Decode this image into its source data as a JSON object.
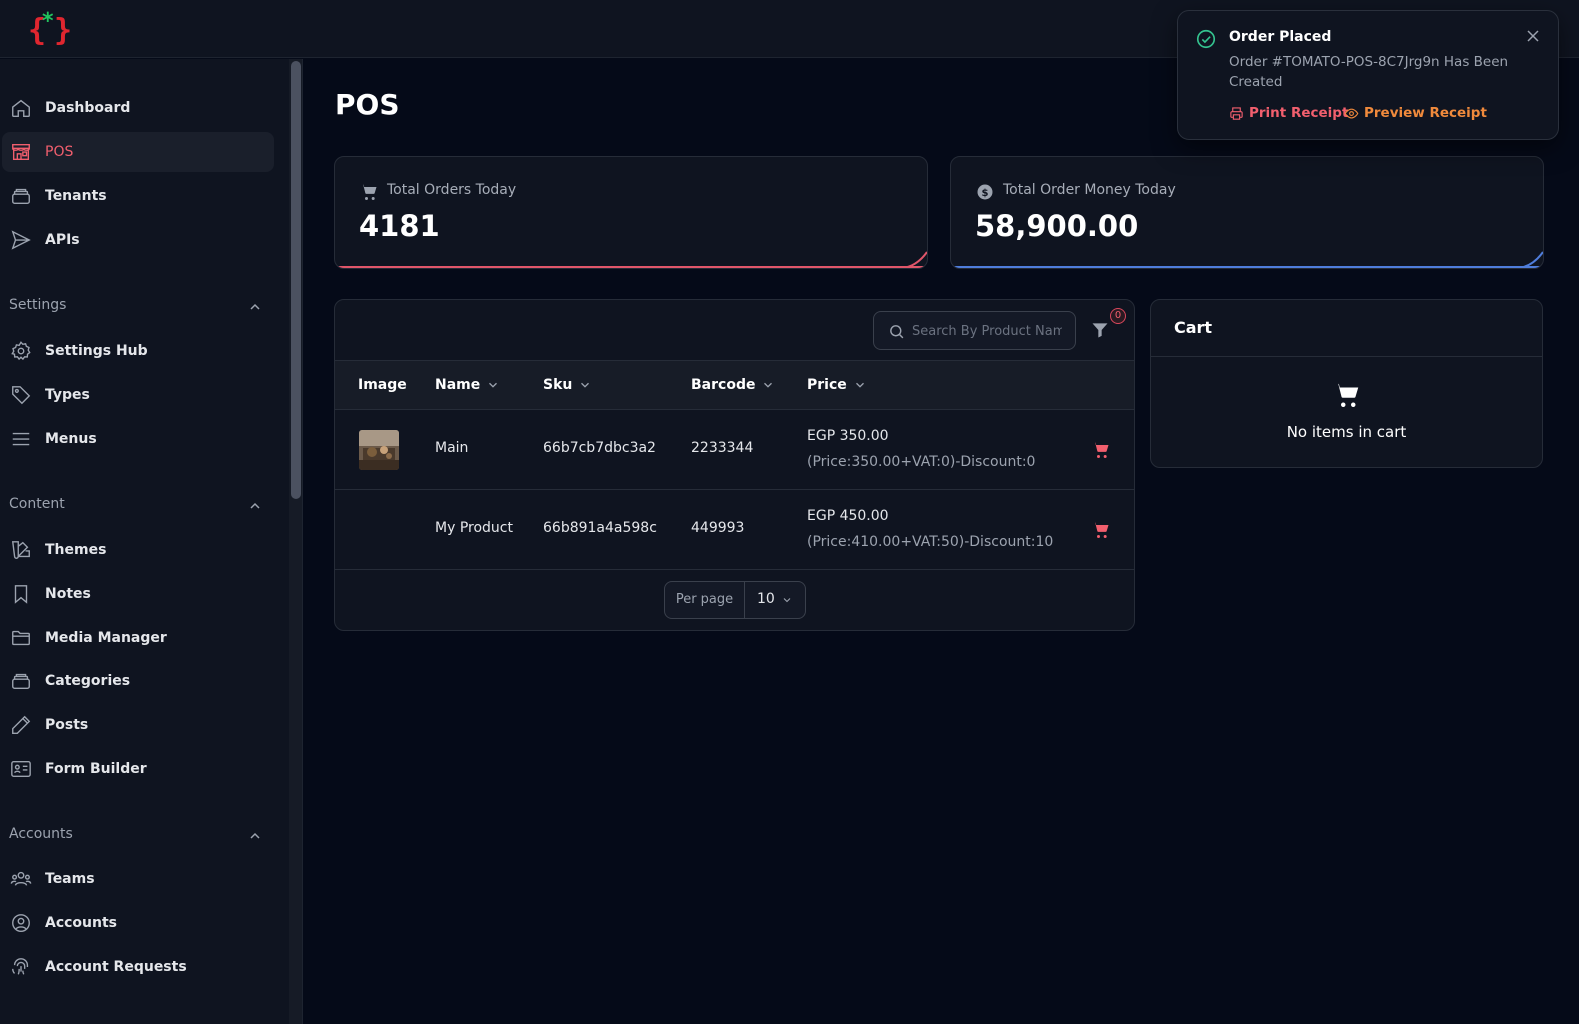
{
  "sidebar": {
    "items": [
      {
        "label": "Dashboard",
        "icon": "home-icon"
      },
      {
        "label": "POS",
        "icon": "store-icon",
        "active": true
      },
      {
        "label": "Tenants",
        "icon": "stack-icon"
      },
      {
        "label": "APIs",
        "icon": "paper-plane-icon"
      }
    ],
    "sections": [
      {
        "title": "Settings",
        "items": [
          {
            "label": "Settings Hub",
            "icon": "gear-icon"
          },
          {
            "label": "Types",
            "icon": "tag-icon"
          },
          {
            "label": "Menus",
            "icon": "menu-icon"
          }
        ]
      },
      {
        "title": "Content",
        "items": [
          {
            "label": "Themes",
            "icon": "swatch-icon"
          },
          {
            "label": "Notes",
            "icon": "bookmark-icon"
          },
          {
            "label": "Media Manager",
            "icon": "folder-icon"
          },
          {
            "label": "Categories",
            "icon": "stack-icon"
          },
          {
            "label": "Posts",
            "icon": "pencil-icon"
          },
          {
            "label": "Form Builder",
            "icon": "id-card-icon"
          }
        ]
      },
      {
        "title": "Accounts",
        "items": [
          {
            "label": "Teams",
            "icon": "users-icon"
          },
          {
            "label": "Accounts",
            "icon": "user-circle-icon"
          },
          {
            "label": "Account Requests",
            "icon": "fingerprint-icon"
          }
        ]
      }
    ]
  },
  "main": {
    "title": "POS",
    "stats": [
      {
        "label": "Total Orders Today",
        "value": "4181",
        "icon": "cart-icon",
        "accent": "#e0566a"
      },
      {
        "label": "Total Order Money Today",
        "value": "58,900.00",
        "icon": "currency-icon",
        "accent": "#4f7ddb"
      }
    ],
    "table": {
      "search_placeholder": "Search By Product Name",
      "filter_count": "0",
      "columns": [
        "Image",
        "Name",
        "Sku",
        "Barcode",
        "Price"
      ],
      "rows": [
        {
          "name": "Main",
          "sku": "66b7cb7dbc3a2",
          "barcode": "2233344",
          "price": "EGP 350.00",
          "price_detail": "(Price:350.00+VAT:0)-Discount:0",
          "has_image": true
        },
        {
          "name": "My Product",
          "sku": "66b891a4a598c",
          "barcode": "449993",
          "price": "EGP 450.00",
          "price_detail": "(Price:410.00+VAT:50)-Discount:10",
          "has_image": false
        }
      ],
      "per_page_label": "Per page",
      "per_page_value": "10"
    },
    "cart": {
      "title": "Cart",
      "empty_text": "No items in cart"
    }
  },
  "toast": {
    "title": "Order Placed",
    "body": "Order #TOMATO-POS-8C7Jrg9n Has Been Created",
    "print_label": "Print Receipt",
    "preview_label": "Preview Receipt"
  },
  "colors": {
    "accent": "#f25f6e",
    "warning": "#f08a3c",
    "success": "#34c38f"
  }
}
